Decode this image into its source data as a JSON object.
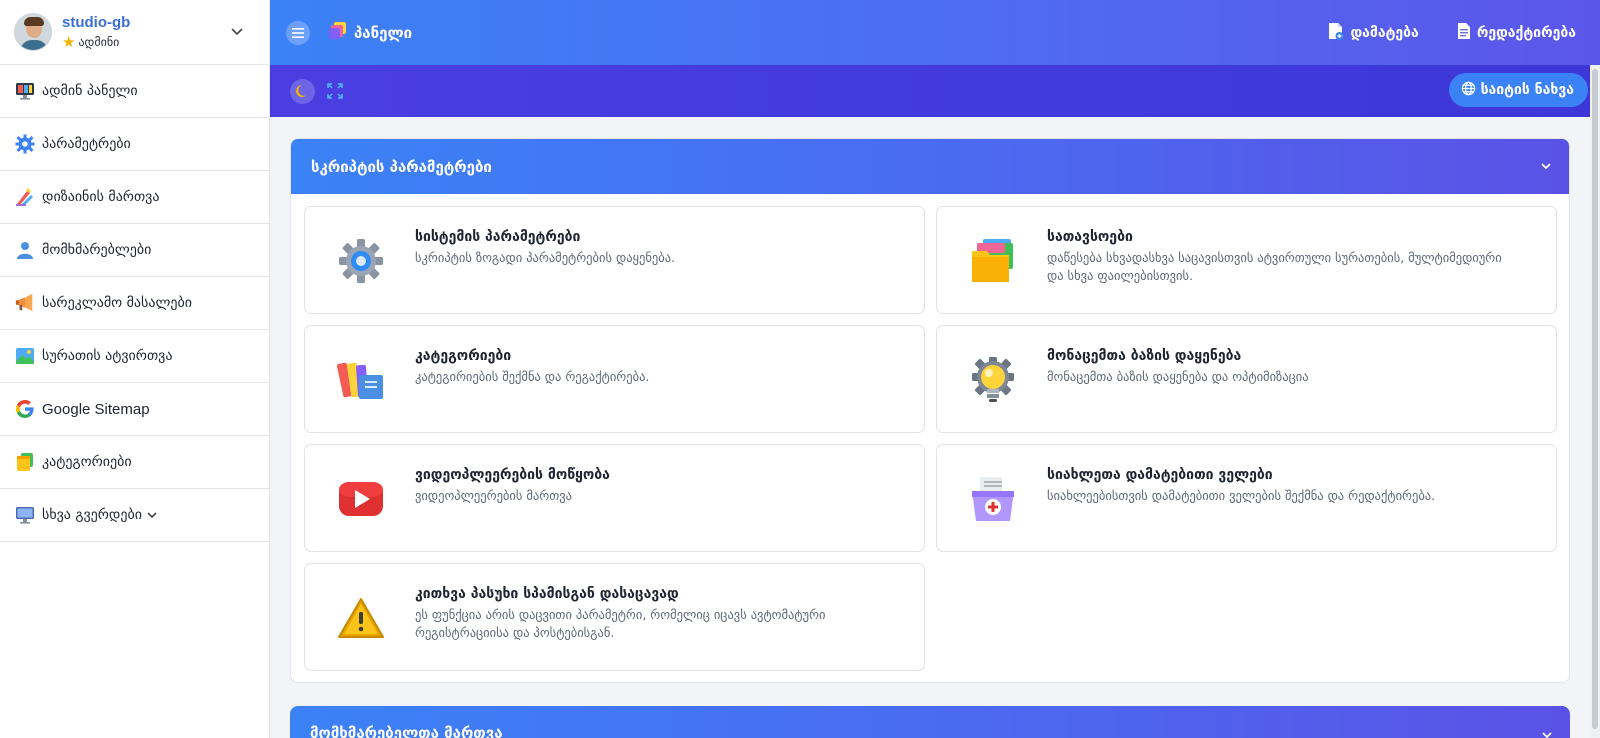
{
  "user": {
    "name": "studio-gb",
    "role": "ადმინი"
  },
  "sidebar": {
    "items": [
      {
        "label": "ადმინ პანელი",
        "icon": "monitor-icon"
      },
      {
        "label": "პარამეტრები",
        "icon": "gear-icon"
      },
      {
        "label": "დიზაინის მართვა",
        "icon": "paint-brush-icon"
      },
      {
        "label": "მომხმარებლები",
        "icon": "user-icon"
      },
      {
        "label": "სარეკლამო მასალები",
        "icon": "megaphone-icon"
      },
      {
        "label": "სურათის ატვირთვა",
        "icon": "image-icon"
      },
      {
        "label": "Google Sitemap",
        "icon": "google-icon"
      },
      {
        "label": "კატეგორიები",
        "icon": "categories-icon"
      },
      {
        "label": "სხვა გვერდები",
        "icon": "desktop-icon"
      }
    ]
  },
  "topbar": {
    "title": "პანელი",
    "add_label": "დამატება",
    "edit_label": "რედაქტირება"
  },
  "subbar": {
    "site_view_label": "საიტის ნახვა"
  },
  "section1": {
    "title": "სკრიპტის პარამეტრები",
    "tiles": [
      {
        "title": "სისტემის პარამეტრები",
        "desc": "სკრიპტის ზოგადი პარამეტრების დაყენება.",
        "icon": "gear-icon"
      },
      {
        "title": "სათავსოები",
        "desc": "დაწესება სხვადასხვა საცავისთვის ატვირთული სურათების, მულტიმედიური და სხვა ფაილებისთვის.",
        "icon": "folders-icon"
      },
      {
        "title": "კატეგორიები",
        "desc": "კატეგირიების შექმნა და რეგაქტირება.",
        "icon": "books-icon"
      },
      {
        "title": "მონაცემთა ბაზის დაყენება",
        "desc": "მონაცემთა ბაზის დაყენება და ოპტიმიზაცია",
        "icon": "bulb-gear-icon"
      },
      {
        "title": "ვიდეოპლეერების მოწყობა",
        "desc": "ვიდეოპლეერების მართვა",
        "icon": "play-icon"
      },
      {
        "title": "სიახლეთა დამატებითი ველები",
        "desc": "სიახლეებისთვის დამატებითი ველების შექმნა და რედაქტირება.",
        "icon": "medkit-icon"
      },
      {
        "title": "კითხვა პასუხი სპამისგან დასაცავად",
        "desc": "ეს ფუნქცია არის დაცვითი პარამეტრი, რომელიც იცავს ავტომატური რეგისტრაციისა და პოსტებისგან.",
        "icon": "warning-icon"
      }
    ]
  },
  "section2": {
    "title": "მომხმარებელთა მართვა"
  },
  "colors": {
    "accent": "#3b82f6",
    "indigo": "#3d37d8",
    "purple": "#5a52e6"
  }
}
